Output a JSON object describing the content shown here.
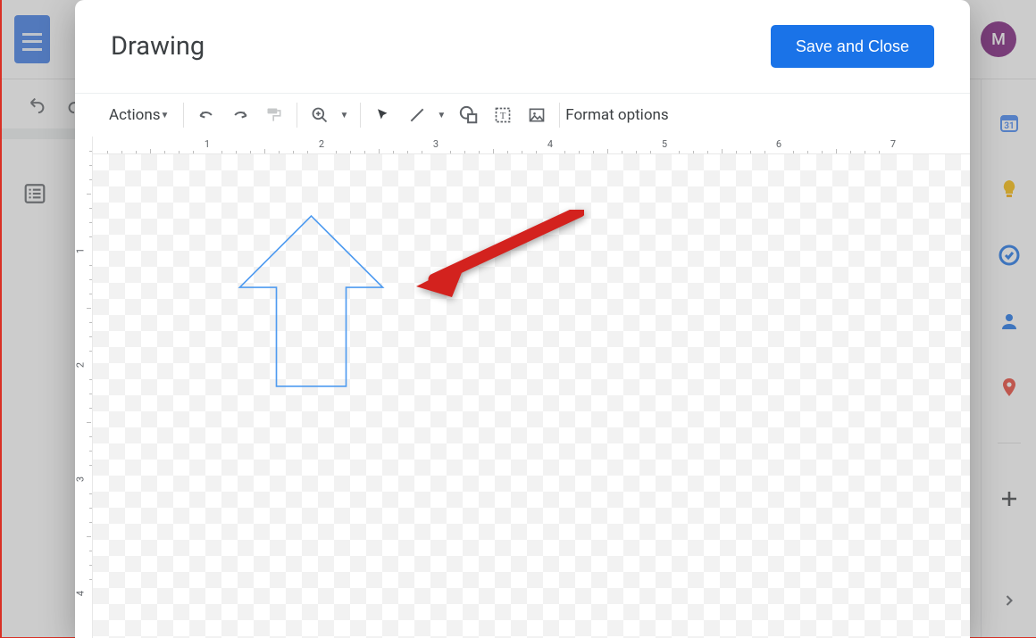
{
  "dialog": {
    "title": "Drawing",
    "save_button": "Save and Close",
    "toolbar": {
      "actions_label": "Actions",
      "format_options": "Format options"
    },
    "ruler_numbers": [
      "1",
      "2",
      "3",
      "4",
      "5",
      "6",
      "7"
    ],
    "vruler_numbers": [
      "1",
      "2",
      "3",
      "4"
    ],
    "drawn_shape": {
      "type": "up-arrow",
      "stroke": "#4f9bf0",
      "fill": "none"
    }
  },
  "avatar_initial": "M"
}
